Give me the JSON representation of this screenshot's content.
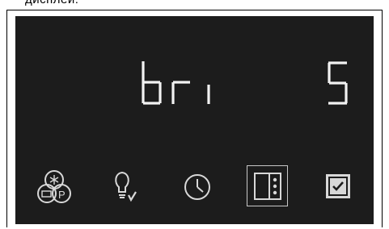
{
  "caption": "дисплей:",
  "display": {
    "setting_code": "bri",
    "setting_value": "5"
  },
  "toolbar": {
    "items": [
      {
        "icon": "fridge-freezer-party-icon",
        "label": ""
      },
      {
        "icon": "light-bulb-icon",
        "label": ""
      },
      {
        "icon": "clock-icon",
        "label": ""
      },
      {
        "icon": "settings-menu-icon",
        "label": "",
        "selected": true
      },
      {
        "icon": "confirm-checkbox-icon",
        "label": ""
      }
    ]
  },
  "colors": {
    "panel": "#1c1c1c",
    "segment": "#f2f2f2",
    "icon": "#d8d8d8"
  }
}
